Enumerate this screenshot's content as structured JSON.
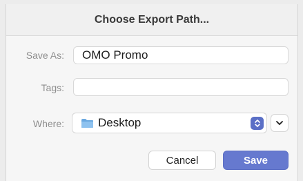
{
  "dialog": {
    "title": "Choose Export Path...",
    "save_as": {
      "label": "Save As:",
      "value": "OMO Promo"
    },
    "tags": {
      "label": "Tags:",
      "value": ""
    },
    "where": {
      "label": "Where:",
      "value": "Desktop"
    },
    "buttons": {
      "cancel": "Cancel",
      "save": "Save"
    }
  },
  "icons": {
    "where_icon": "folder-icon",
    "stepper_icon": "up-down-chevron-icon",
    "expand_icon": "chevron-down-icon"
  },
  "colors": {
    "accent": "#6679cf",
    "stepper": "#5a6fc6",
    "folder": "#6aa8e0"
  }
}
